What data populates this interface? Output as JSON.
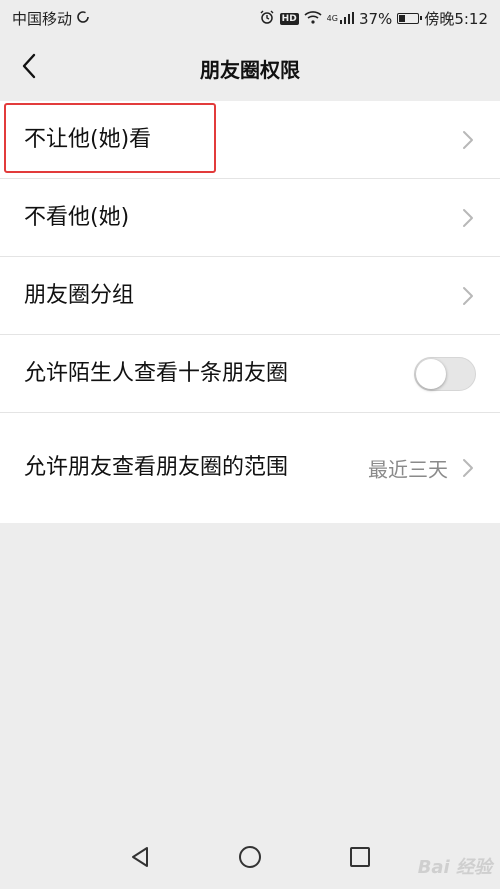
{
  "status_bar": {
    "carrier": "中国移动",
    "network": "4G",
    "battery": "37%",
    "battery_level": 0.37,
    "time": "傍晚5:12"
  },
  "nav": {
    "title": "朋友圈权限",
    "back_icon": "chevron-left-icon"
  },
  "settings": {
    "items": [
      {
        "label": "不让他(她)看",
        "control": "chevron"
      },
      {
        "label": "不看他(她)",
        "control": "chevron"
      },
      {
        "label": "朋友圈分组",
        "control": "chevron"
      },
      {
        "label": "允许陌生人查看十条朋友圈",
        "control": "toggle",
        "toggle_on": false
      },
      {
        "label": "允许朋友查看朋友圈的范围",
        "value": "最近三天",
        "control": "chevron"
      }
    ]
  },
  "highlight_color": "#e23b3b",
  "watermark": "Bai 经验"
}
